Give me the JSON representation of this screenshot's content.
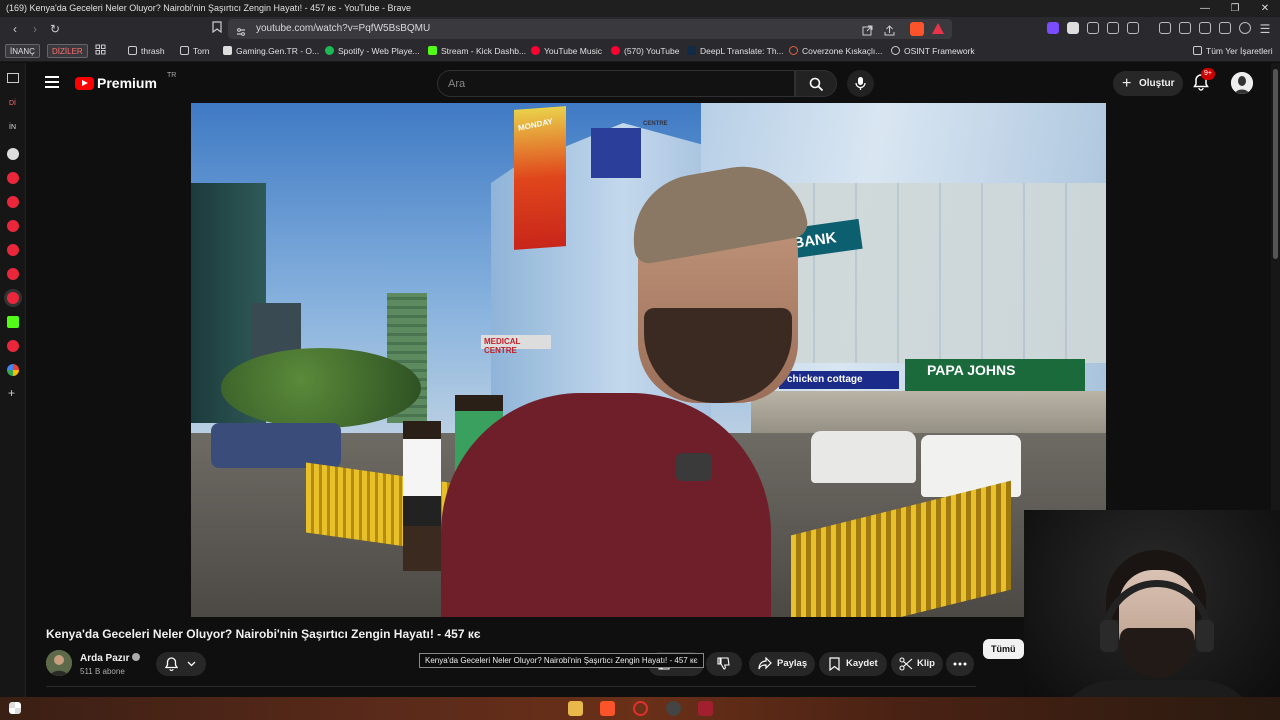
{
  "window": {
    "title": "(169) Kenya'da Geceleri Neler Oluyor? Nairobi'nin Şaşırtıcı Zengin Hayatı! - 457 кє - YouTube - Brave"
  },
  "browser": {
    "url": "youtube.com/watch?v=PqfW5BsBQMU",
    "bookmark_tags": [
      "İNANÇ",
      "DİZİLER"
    ],
    "bookmarks": [
      {
        "label": "thrash",
        "icon": "folder-icon"
      },
      {
        "label": "Torn",
        "icon": "folder-icon"
      },
      {
        "label": "Gaming.Gen.TR - O...",
        "icon": "site-icon"
      },
      {
        "label": "Spotify - Web Playe...",
        "icon": "spotify-icon"
      },
      {
        "label": "Stream - Kick Dashb...",
        "icon": "kick-icon"
      },
      {
        "label": "YouTube Music",
        "icon": "youtube-music-icon"
      },
      {
        "label": "(570) YouTube",
        "icon": "youtube-icon"
      },
      {
        "label": "DeepL Translate: Th...",
        "icon": "deepl-icon"
      },
      {
        "label": "Coverzone Kıskaçlı...",
        "icon": "site-icon"
      },
      {
        "label": "OSINT Framework",
        "icon": "osint-icon"
      }
    ],
    "all_bookmarks": "Tüm Yer İşaretleri",
    "accent": "#fb542b"
  },
  "youtube": {
    "logo_text": "Premium",
    "logo_region": "TR",
    "search_placeholder": "Ara",
    "create_label": "Oluştur",
    "notification_count": "9+",
    "video_title": "Kenya'da Geceleri Neler Oluyor? Nairobi'nin Şaşırtıcı Zengin Hayatı! - 457 кє",
    "channel_name": "Arda Pazır",
    "subscribers": "511 B abone",
    "tooltip": "Kenya'da Geceleri Neler Oluyor? Nairobi'nin Şaşırtıcı Zengin Hayatı! - 457 кє",
    "actions": {
      "share": "Paylaş",
      "save": "Kaydet",
      "clip": "Klip"
    },
    "chip_all": "Tümü",
    "brand_red": "#ff0000"
  },
  "video_scene": {
    "signs": [
      "E BANK",
      "MEDICAL CENTRE",
      "PAPA JOHNS",
      "chicken cottage",
      "CENTRE",
      "MONDAY"
    ]
  },
  "sidebar": {
    "tags": [
      "Dİ",
      "İN"
    ]
  }
}
